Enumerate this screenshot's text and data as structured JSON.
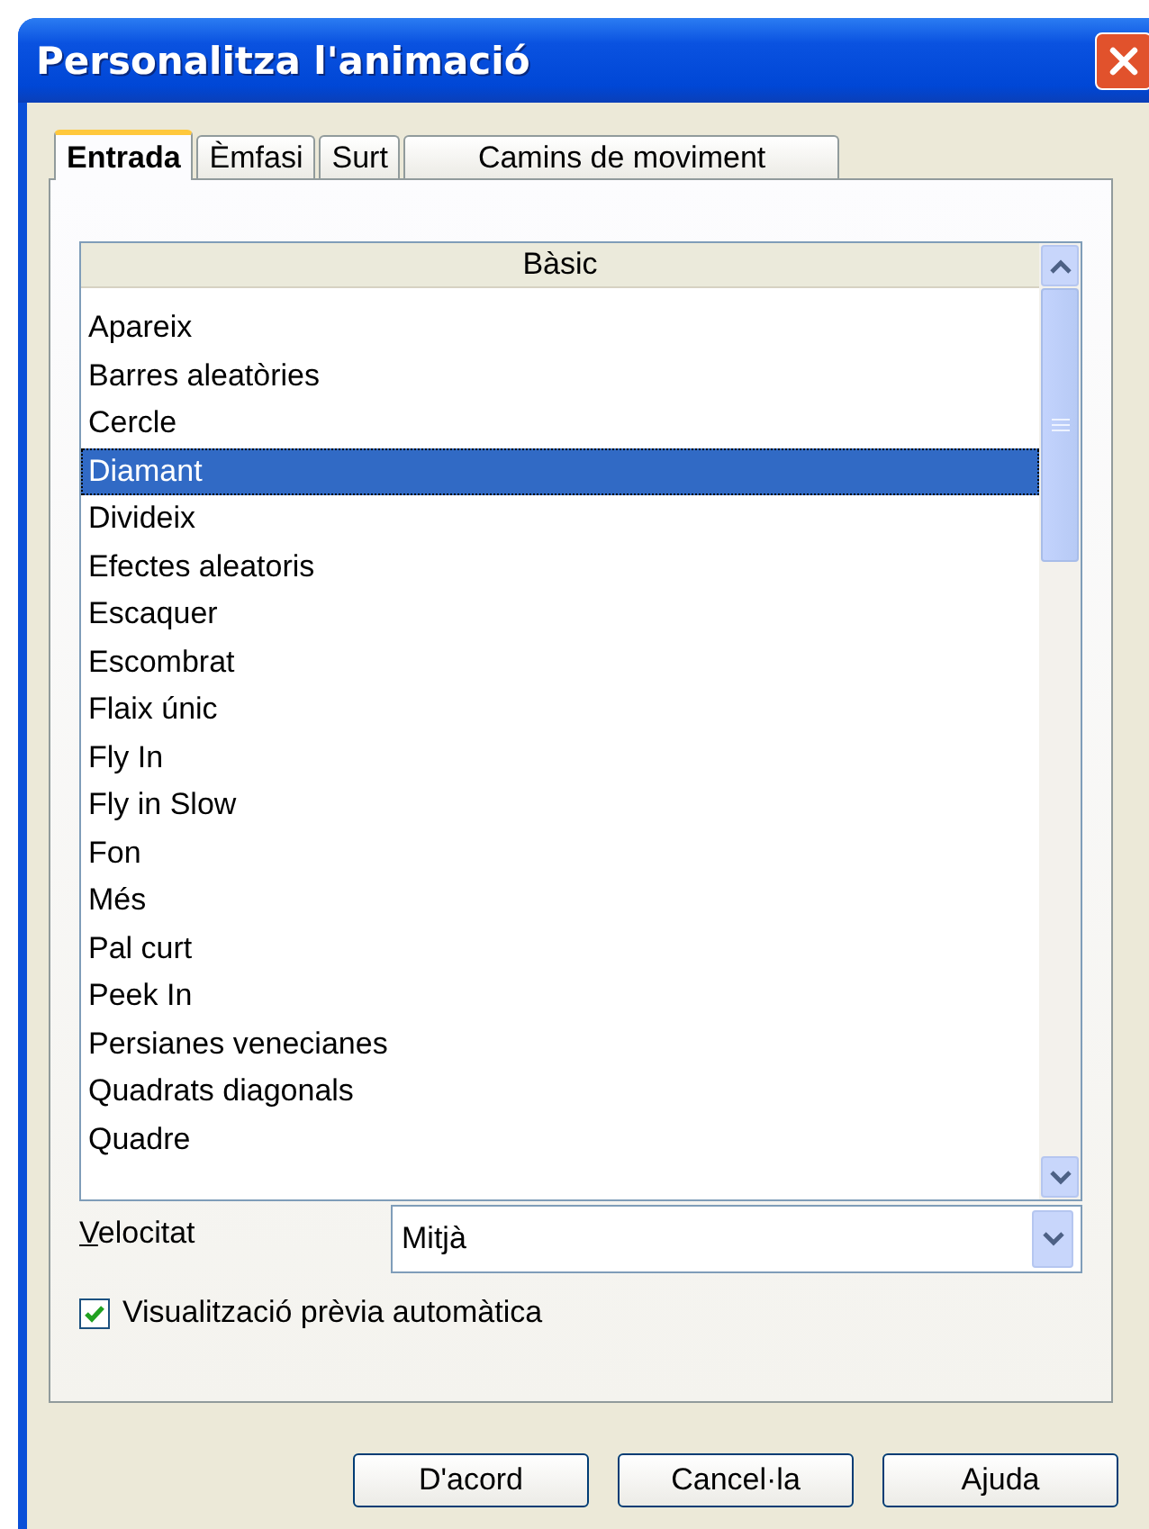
{
  "window": {
    "title": "Personalitza l'animació"
  },
  "tabs": [
    {
      "label": "Entrada",
      "selected": true
    },
    {
      "label": "Èmfasi",
      "selected": false
    },
    {
      "label": "Surt",
      "selected": false
    },
    {
      "label": "Camins de moviment",
      "selected": false
    }
  ],
  "list": {
    "header": "Bàsic",
    "items": [
      {
        "label": "Apareix",
        "selected": false
      },
      {
        "label": "Barres aleatòries",
        "selected": false
      },
      {
        "label": "Cercle",
        "selected": false
      },
      {
        "label": "Diamant",
        "selected": true
      },
      {
        "label": "Divideix",
        "selected": false
      },
      {
        "label": "Efectes aleatoris",
        "selected": false
      },
      {
        "label": "Escaquer",
        "selected": false
      },
      {
        "label": "Escombrat",
        "selected": false
      },
      {
        "label": "Flaix únic",
        "selected": false
      },
      {
        "label": "Fly In",
        "selected": false
      },
      {
        "label": "Fly in Slow",
        "selected": false
      },
      {
        "label": "Fon",
        "selected": false
      },
      {
        "label": "Més",
        "selected": false
      },
      {
        "label": "Pal curt",
        "selected": false
      },
      {
        "label": "Peek In",
        "selected": false
      },
      {
        "label": "Persianes venecianes",
        "selected": false
      },
      {
        "label": "Quadrats diagonals",
        "selected": false
      },
      {
        "label": "Quadre",
        "selected": false
      }
    ]
  },
  "speed": {
    "label": "Velocitat",
    "value": "Mitjà"
  },
  "autopreview": {
    "label": "Visualització prèvia automàtica",
    "checked": true
  },
  "buttons": [
    {
      "label": "D'acord"
    },
    {
      "label": "Cancel·la"
    },
    {
      "label": "Ajuda"
    }
  ]
}
